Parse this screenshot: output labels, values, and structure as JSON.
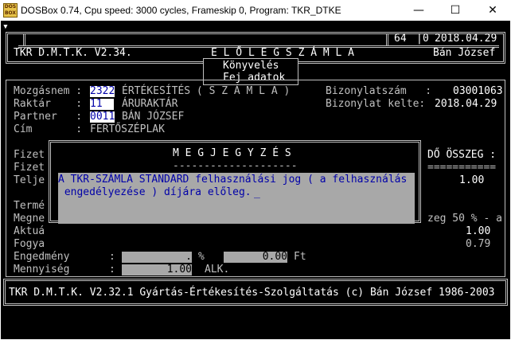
{
  "window": {
    "title": "DOSBox 0.74, Cpu speed:     3000 cycles, Frameskip  0, Program: TKR_DTKE",
    "minimize": "—",
    "maximize": "☐",
    "close": "✕"
  },
  "header": {
    "corner_mark": "▾",
    "counter1": "64",
    "counter2": "0",
    "date": "2018.04.29",
    "app_name": "TKR D.M.T.K. V2.34.",
    "doc_title": "E L Ő L E G S Z Á M L A",
    "user": "Bán József",
    "menu1": "Könyvelés",
    "menu2": "Fej adatok"
  },
  "form": {
    "movement_label": "Mozgásnem :",
    "movement_code": "2322",
    "movement_name": "ÉRTÉKESÍTÉS ( S Z Á M L A )",
    "warehouse_label": "Raktár    :",
    "warehouse_code": "11",
    "warehouse_name": "ÁRURAKTÁR",
    "partner_label": "Partner   :",
    "partner_code": "0011",
    "partner_name": "BÁN JÓZSEF",
    "address_label": "Cím       :",
    "address_value": "FERTŐSZÉPLAK",
    "docnum_label": "Bizonylatszám   :",
    "docnum_value": "03001063",
    "docdate_label": "Bizonylat kelte:",
    "docdate_value": "2018.04.29",
    "left_stub1": "Fizet",
    "left_stub2": "Fizet",
    "left_stub3": "Telje",
    "left_stub4": "Termé",
    "left_stub5": "Megne",
    "left_stub6": "Aktuá",
    "left_stub7": "Fogya",
    "total_label": "DŐ ÖSSZEG :",
    "total_sep": "===========",
    "total_value": "1.00",
    "right_text": "zeg 50 % - a",
    "right_val1": "1.00",
    "right_val2": "0.79",
    "discount_label": "Engedmény",
    "discount_colon": ":",
    "discount_value": ".",
    "discount_pct": "%",
    "discount_amount": "0.00",
    "discount_unit": "Ft",
    "qty_label": "Mennyiség",
    "qty_colon": ":",
    "qty_value": "1.00",
    "qty_unit": "ALK."
  },
  "dialog": {
    "title": "M E G J E G Y Z É S",
    "underline": "--------------------",
    "line1": "A TKR-SZÁMLA STANDARD felhasználási jog ( a felhasználás",
    "line2": " engedélyezése ) díjára előleg."
  },
  "footer": {
    "text": "TKR D.M.T.K. V2.32.1 Gyártás-Értékesítés-Szolgáltatás (c) Bán József 1986-2003"
  }
}
